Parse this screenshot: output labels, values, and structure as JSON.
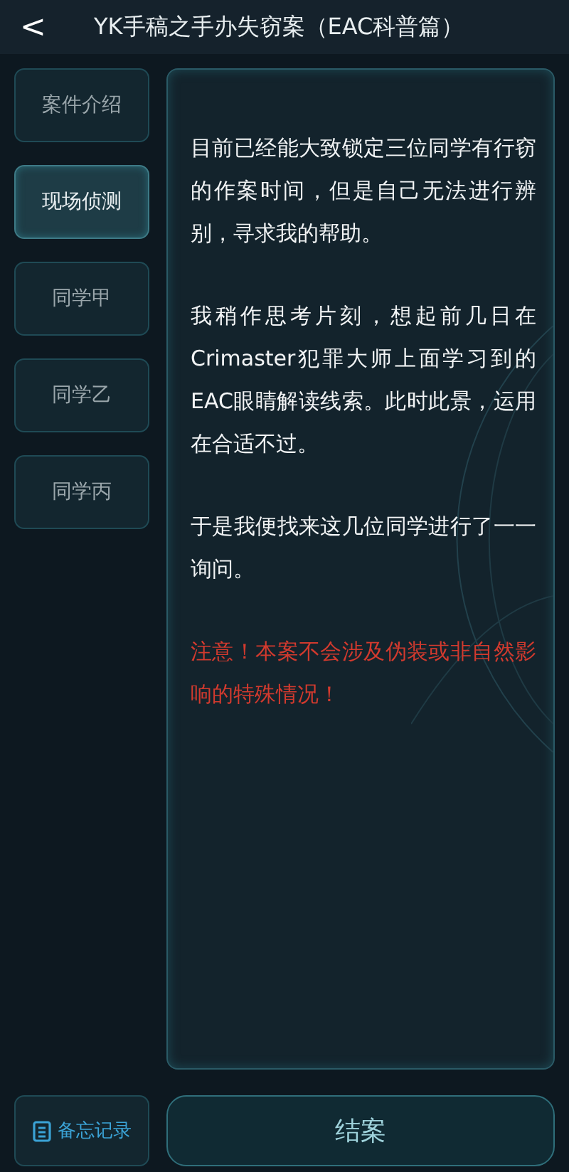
{
  "header": {
    "back": "<",
    "title": "YK手稿之手办失窃案（EAC科普篇）"
  },
  "sidebar": {
    "items": [
      {
        "label": "案件介绍",
        "selected": false
      },
      {
        "label": "现场侦测",
        "selected": true
      },
      {
        "label": "同学甲",
        "selected": false
      },
      {
        "label": "同学乙",
        "selected": false
      },
      {
        "label": "同学丙",
        "selected": false
      }
    ]
  },
  "content": {
    "paragraphs": [
      {
        "kind": "normal",
        "text": "目前已经能大致锁定三位同学有行窃的作案时间，但是自己无法进行辨别，寻求我的帮助。"
      },
      {
        "kind": "normal",
        "text": "我稍作思考片刻，想起前几日在Crimaster犯罪大师上面学习到的EAC眼睛解读线索。此时此景，运用在合适不过。"
      },
      {
        "kind": "normal",
        "text": "于是我便找来这几位同学进行了一一询问。"
      },
      {
        "kind": "warning",
        "text": "注意！本案不会涉及伪装或非自然影响的特殊情况！"
      }
    ]
  },
  "footer": {
    "memo": "备忘记录",
    "close_case": "结案"
  }
}
